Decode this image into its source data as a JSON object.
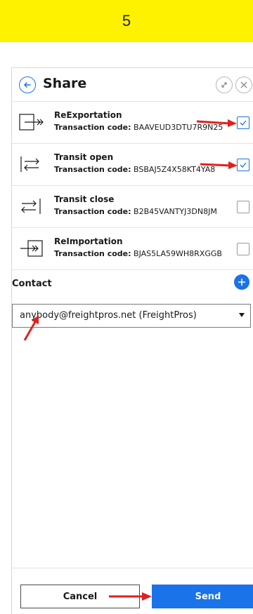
{
  "step": {
    "number": "5"
  },
  "header": {
    "title": "Share",
    "back_icon": "circle-arrow-left-icon",
    "expand_icon": "expand-icon",
    "close_icon": "close-icon"
  },
  "items": [
    {
      "name": "ReExportation",
      "code_label": "Transaction code:",
      "code": "BAAVEUD3DTU7R9N25",
      "checked": true,
      "icon": "reexport-icon"
    },
    {
      "name": "Transit open",
      "code_label": "Transaction code:",
      "code": "BSBAJ5Z4X58KT4YA8",
      "checked": true,
      "icon": "transit-open-icon"
    },
    {
      "name": "Transit close",
      "code_label": "Transaction code:",
      "code": "B2B45VANTYJ3DN8JM",
      "checked": false,
      "icon": "transit-close-icon"
    },
    {
      "name": "ReImportation",
      "code_label": "Transaction code:",
      "code": "BJAS5LA59WH8RXGGB",
      "checked": false,
      "icon": "reimport-icon"
    }
  ],
  "contact": {
    "label": "Contact",
    "selected": "anybody@freightpros.net (FreightPros)",
    "add_icon": "plus-icon"
  },
  "footer": {
    "cancel_label": "Cancel",
    "send_label": "Send"
  },
  "colors": {
    "banner": "#fff200",
    "accent": "#1a73e8",
    "annotation_arrow": "#e02020"
  }
}
